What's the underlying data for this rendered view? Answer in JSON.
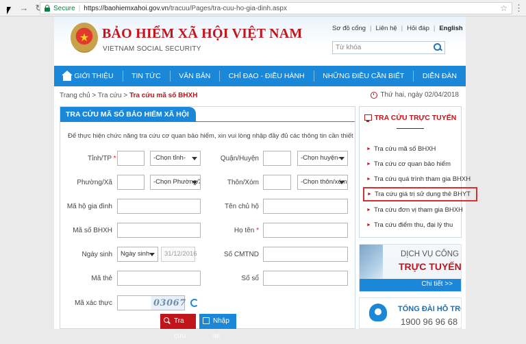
{
  "browser": {
    "secure_label": "Secure",
    "url_host": "https://baohiemxahoi.gov.vn",
    "url_path": "/tracuu/Pages/tra-cuu-ho-gia-dinh.aspx"
  },
  "header": {
    "brand_vn": "BẢO HIỂM XÃ HỘI VIỆT NAM",
    "brand_en": "VIETNAM SOCIAL SECURITY",
    "links": [
      "Sơ đồ cổng",
      "Liên hệ",
      "Hỏi đáp",
      "English"
    ],
    "search_placeholder": "Từ khóa"
  },
  "nav": [
    "GIỚI THIỆU",
    "TIN TỨC",
    "VĂN BẢN",
    "CHỈ ĐẠO - ĐIỀU HÀNH",
    "NHỮNG ĐIỀU CẦN BIẾT",
    "DIỄN ĐÀN"
  ],
  "breadcrumb": {
    "home": "Trang chủ >",
    "section": "Tra cứu >",
    "current": "Tra cứu mã số BHXH"
  },
  "date": "Thứ hai, ngày 02/04/2018",
  "form": {
    "title": "TRA CỨU MÃ SỐ BẢO HIỂM XÃ HỘI",
    "intro": "Để thực hiện chức năng tra cứu cơ quan bảo hiểm, xin vui lòng nhập đầy đủ các thông tin cần thiết",
    "province_label": "Tỉnh/TP",
    "province_select": "-Chọn tỉnh-",
    "district_label": "Quận/Huyện",
    "district_select": "-Chọn huyện-",
    "ward_label": "Phường/Xã",
    "ward_select": "-Chọn Phường/Xã-",
    "hamlet_label": "Thôn/Xóm",
    "hamlet_select": "-Chọn thôn/xóm-",
    "household_label": "Mã hộ gia đình",
    "owner_label": "Tên chủ hộ",
    "bhxh_label": "Mã số BHXH",
    "fullname_label": "Họ tên",
    "dob_label": "Ngày sinh",
    "dob_select": "Ngày sinh",
    "dob_value": "31/12/2016",
    "id_label": "Số CMTND",
    "card_label": "Mã thẻ",
    "book_label": "Số sổ",
    "captcha_label": "Mã xác thực",
    "captcha_text": "03067",
    "required_mark": "*",
    "search_button": "Tra cứu",
    "reset_button": "Nhập lại"
  },
  "sidebar": {
    "title": "TRA CỨU TRỰC TUYẾN",
    "items": [
      "Tra cứu mã số BHXH",
      "Tra cứu cơ quan bảo hiểm",
      "Tra cứu quá trình tham gia BHXH",
      "Tra cứu giá trị sử dụng thẻ BHYT",
      "Tra cứu đơn vị tham gia BHXH",
      "Tra cứu điểm thu, đại lý thu"
    ],
    "highlight_color": "#d9302c"
  },
  "banner1": {
    "line1": "DỊCH VỤ CÔNG",
    "line2": "TRỰC TUYẾN",
    "more": "Chi tiết >>"
  },
  "banner2": {
    "line1": "TỔNG ĐÀI HỖ TRỢ",
    "line2": "1900 96 96 68"
  },
  "colors": {
    "brand_red": "#c2141b",
    "nav_blue": "#1a87d8"
  }
}
